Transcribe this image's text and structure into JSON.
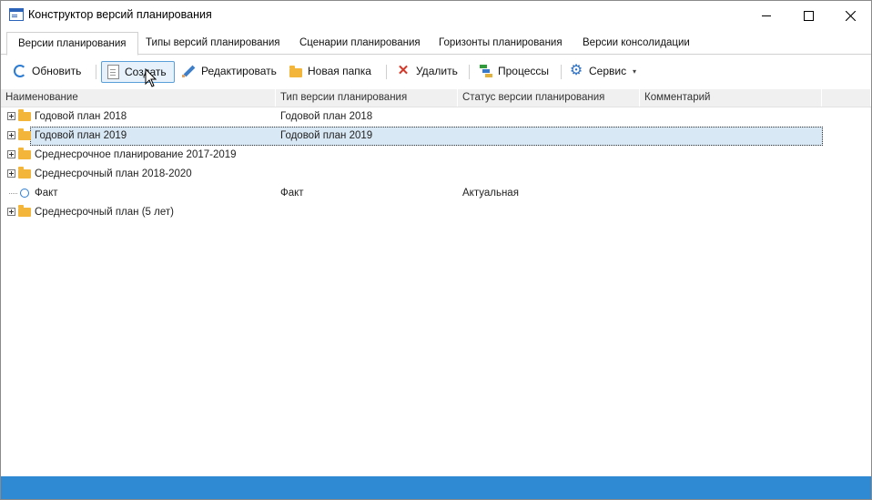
{
  "window": {
    "title": "Конструктор версий планирования",
    "controls": {
      "minimize": "minimize",
      "maximize": "maximize",
      "close": "close"
    }
  },
  "tabs": [
    {
      "label": "Версии планирования",
      "active": true
    },
    {
      "label": "Типы версий планирования",
      "active": false
    },
    {
      "label": "Сценарии планирования",
      "active": false
    },
    {
      "label": "Горизонты планирования",
      "active": false
    },
    {
      "label": "Версии консолидации",
      "active": false
    }
  ],
  "toolbar": {
    "refresh": {
      "label": "Обновить",
      "icon": "refresh-icon"
    },
    "create": {
      "label": "Создать",
      "icon": "document-icon",
      "hovered": true
    },
    "edit": {
      "label": "Редактировать",
      "icon": "pencil-icon"
    },
    "new_folder": {
      "label": "Новая папка",
      "icon": "folder-icon"
    },
    "delete": {
      "label": "Удалить",
      "icon": "delete-x-icon"
    },
    "processes": {
      "label": "Процессы",
      "icon": "processes-icon"
    },
    "service": {
      "label": "Сервис",
      "icon": "gear-icon",
      "dropdown": "▾"
    }
  },
  "grid": {
    "columns": [
      "Наименование",
      "Тип версии планирования",
      "Статус версии планирования",
      "Комментарий"
    ],
    "rows": [
      {
        "name": "Годовой план 2018",
        "type": "Годовой план 2018",
        "status": "",
        "comment": "",
        "kind": "folder",
        "selected": false
      },
      {
        "name": "Годовой план 2019",
        "type": "Годовой план 2019",
        "status": "",
        "comment": "",
        "kind": "folder",
        "selected": true
      },
      {
        "name": "Среднесрочное планирование 2017-2019",
        "type": "",
        "status": "",
        "comment": "",
        "kind": "folder",
        "selected": false
      },
      {
        "name": "Среднесрочный план 2018-2020",
        "type": "",
        "status": "",
        "comment": "",
        "kind": "folder",
        "selected": false
      },
      {
        "name": "Факт",
        "type": "Факт",
        "status": "Актуальная",
        "comment": "",
        "kind": "version",
        "selected": false
      },
      {
        "name": "Среднесрочный план (5 лет)",
        "type": "",
        "status": "",
        "comment": "",
        "kind": "folder",
        "selected": false
      }
    ]
  },
  "colors": {
    "accent": "#2f8ad3",
    "selection": "#d9e8f5",
    "folder": "#f3b63b"
  }
}
